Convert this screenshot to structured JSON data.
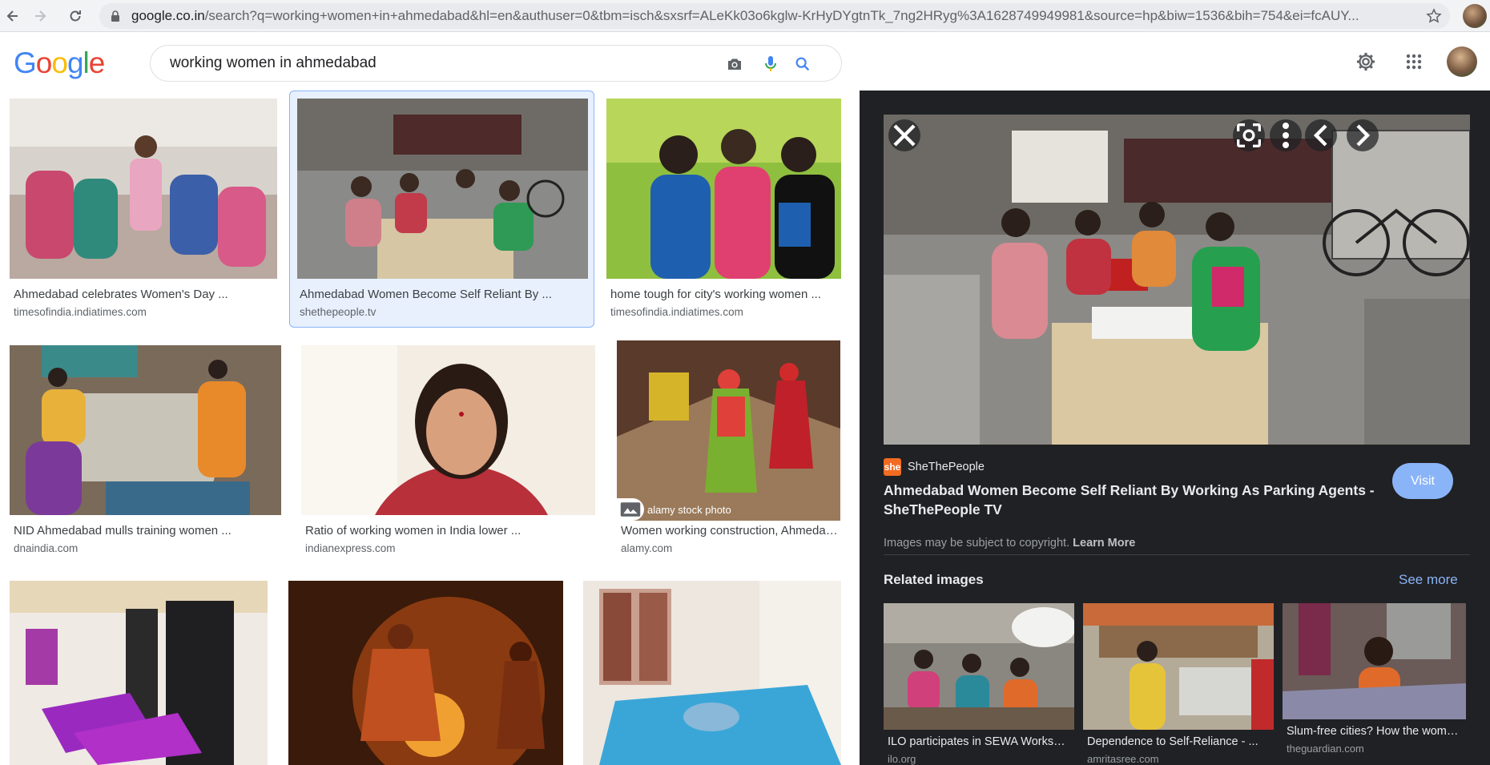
{
  "browser": {
    "url_host": "google.co.in",
    "url_rest": "/search?q=working+women+in+ahmedabad&hl=en&authuser=0&tbm=isch&sxsrf=ALeKk03o6kglw-KrHyDYgtnTk_7ng2HRyg%3A1628749949981&source=hp&biw=1536&bih=754&ei=fcAUY..."
  },
  "header": {
    "logo_letters": [
      "G",
      "o",
      "o",
      "g",
      "l",
      "e"
    ],
    "logo_colors": [
      "#4285f4",
      "#ea4335",
      "#fbbc05",
      "#4285f4",
      "#34a853",
      "#ea4335"
    ],
    "search_query": "working women in ahmedabad"
  },
  "results": [
    {
      "title": "Ahmedabad celebrates Women's Day ...",
      "source": "timesofindia.indiatimes.com"
    },
    {
      "title": "Ahmedabad Women Become Self Reliant By ...",
      "source": "shethepeople.tv"
    },
    {
      "title": "home tough for city's working women ...",
      "source": "timesofindia.indiatimes.com"
    },
    {
      "title": "NID Ahmedabad mulls training women ...",
      "source": "dnaindia.com"
    },
    {
      "title": "Ratio of working women in India lower ...",
      "source": "indianexpress.com"
    },
    {
      "title": "Women working construction, Ahmedabad ...",
      "source": "alamy.com",
      "overlay": "alamy stock photo"
    },
    {
      "title": "",
      "source": ""
    },
    {
      "title": "",
      "source": ""
    },
    {
      "title": "",
      "source": ""
    }
  ],
  "panel": {
    "source_icon": "she",
    "source_name": "SheThePeople",
    "title": "Ahmedabad Women Become Self Reliant By Working As Parking Agents - SheThePeople TV",
    "visit_label": "Visit",
    "copyright_text": "Images may be subject to copyright.",
    "learn_more": "Learn More",
    "related_label": "Related images",
    "see_more": "See more",
    "related": [
      {
        "title": "ILO participates in SEWA Workshop ...",
        "source": "ilo.org"
      },
      {
        "title": "Dependence to Self-Reliance - ...",
        "source": "amritasree.com"
      },
      {
        "title": "Slum-free cities? How the women ...",
        "source": "theguardian.com"
      }
    ]
  },
  "colors": {
    "accent": "#8ab4f8",
    "panel_bg": "#202124",
    "selected_bg": "#e8f0fe"
  }
}
